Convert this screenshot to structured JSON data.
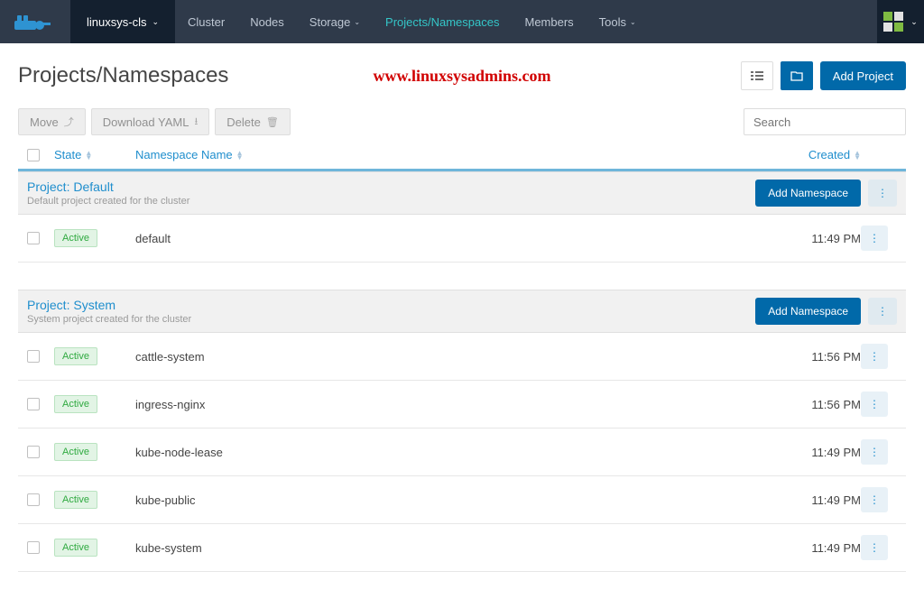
{
  "topbar": {
    "cluster_name": "linuxsys-cls",
    "nav": {
      "cluster": "Cluster",
      "nodes": "Nodes",
      "storage": "Storage",
      "projects": "Projects/Namespaces",
      "members": "Members",
      "tools": "Tools"
    }
  },
  "page": {
    "title": "Projects/Namespaces",
    "watermark": "www.linuxsysadmins.com",
    "add_project": "Add Project"
  },
  "toolbar": {
    "move": "Move",
    "download_yaml": "Download YAML",
    "delete": "Delete",
    "search_placeholder": "Search"
  },
  "columns": {
    "state": "State",
    "namespace_name": "Namespace Name",
    "created": "Created"
  },
  "projects": [
    {
      "title": "Project: Default",
      "description": "Default project created for the cluster",
      "add_ns": "Add Namespace",
      "rows": [
        {
          "state": "Active",
          "name": "default",
          "created": "11:49 PM"
        }
      ]
    },
    {
      "title": "Project: System",
      "description": "System project created for the cluster",
      "add_ns": "Add Namespace",
      "rows": [
        {
          "state": "Active",
          "name": "cattle-system",
          "created": "11:56 PM"
        },
        {
          "state": "Active",
          "name": "ingress-nginx",
          "created": "11:56 PM"
        },
        {
          "state": "Active",
          "name": "kube-node-lease",
          "created": "11:49 PM"
        },
        {
          "state": "Active",
          "name": "kube-public",
          "created": "11:49 PM"
        },
        {
          "state": "Active",
          "name": "kube-system",
          "created": "11:49 PM"
        }
      ]
    }
  ]
}
